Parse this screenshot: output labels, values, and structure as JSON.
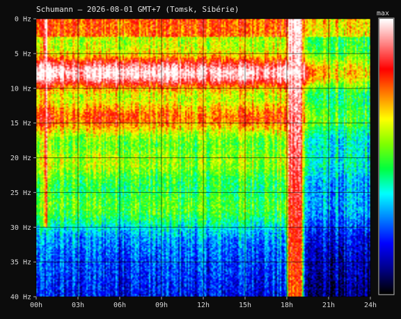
{
  "chart_data": {
    "type": "heatmap",
    "title": "Schumann — 2026-08-01 GMT+7  (Tomsk, Sibérie)",
    "xlabel": "",
    "ylabel": "",
    "x_tick_labels": [
      "00h",
      "03h",
      "06h",
      "09h",
      "12h",
      "15h",
      "18h",
      "21h",
      "24h"
    ],
    "x_range_hours": [
      0,
      24
    ],
    "y_tick_labels": [
      "0 Hz",
      "5 Hz",
      "10 Hz",
      "15 Hz",
      "20 Hz",
      "25 Hz",
      "30 Hz",
      "35 Hz",
      "40 Hz"
    ],
    "y_range_hz": [
      0,
      40
    ],
    "grid": true,
    "colorbar_label": "max",
    "colormap": [
      "#000000",
      "#00008b",
      "#0000ff",
      "#0080ff",
      "#00ffff",
      "#00ff40",
      "#80ff00",
      "#ffff00",
      "#ff8000",
      "#ff0000",
      "#ff8080",
      "#ffffff"
    ],
    "resonance_bands_hz": [
      7.8,
      14.3,
      20.8,
      27.3,
      33.8
    ],
    "band_intensity_by_hour": {
      "hours": [
        0,
        1,
        2,
        3,
        4,
        5,
        6,
        7,
        8,
        9,
        10,
        11,
        12,
        13,
        14,
        15,
        16,
        17,
        18,
        19,
        20,
        21,
        22,
        23,
        24
      ],
      "band_7_8": [
        0.85,
        0.9,
        0.8,
        0.75,
        0.85,
        0.9,
        0.92,
        0.85,
        0.8,
        0.85,
        0.88,
        0.8,
        0.78,
        0.8,
        0.82,
        0.85,
        0.82,
        0.75,
        0.9,
        0.85,
        0.55,
        0.45,
        0.4,
        0.45,
        0.4
      ],
      "band_14_3": [
        0.7,
        0.75,
        0.6,
        0.6,
        0.7,
        0.75,
        0.78,
        0.65,
        0.6,
        0.62,
        0.6,
        0.55,
        0.55,
        0.58,
        0.6,
        0.7,
        0.72,
        0.65,
        0.75,
        0.6,
        0.4,
        0.35,
        0.3,
        0.3,
        0.3
      ],
      "band_20_8": [
        0.55,
        0.6,
        0.5,
        0.5,
        0.55,
        0.6,
        0.6,
        0.5,
        0.45,
        0.45,
        0.45,
        0.42,
        0.42,
        0.45,
        0.5,
        0.55,
        0.5,
        0.45,
        0.6,
        0.45,
        0.3,
        0.28,
        0.25,
        0.25,
        0.25
      ]
    },
    "bursts": [
      {
        "start_h": 0.5,
        "end_h": 0.8,
        "intensity": 1.0,
        "max_hz": 30
      },
      {
        "start_h": 18.05,
        "end_h": 19.25,
        "intensity": 1.0,
        "max_hz": 40
      }
    ]
  }
}
